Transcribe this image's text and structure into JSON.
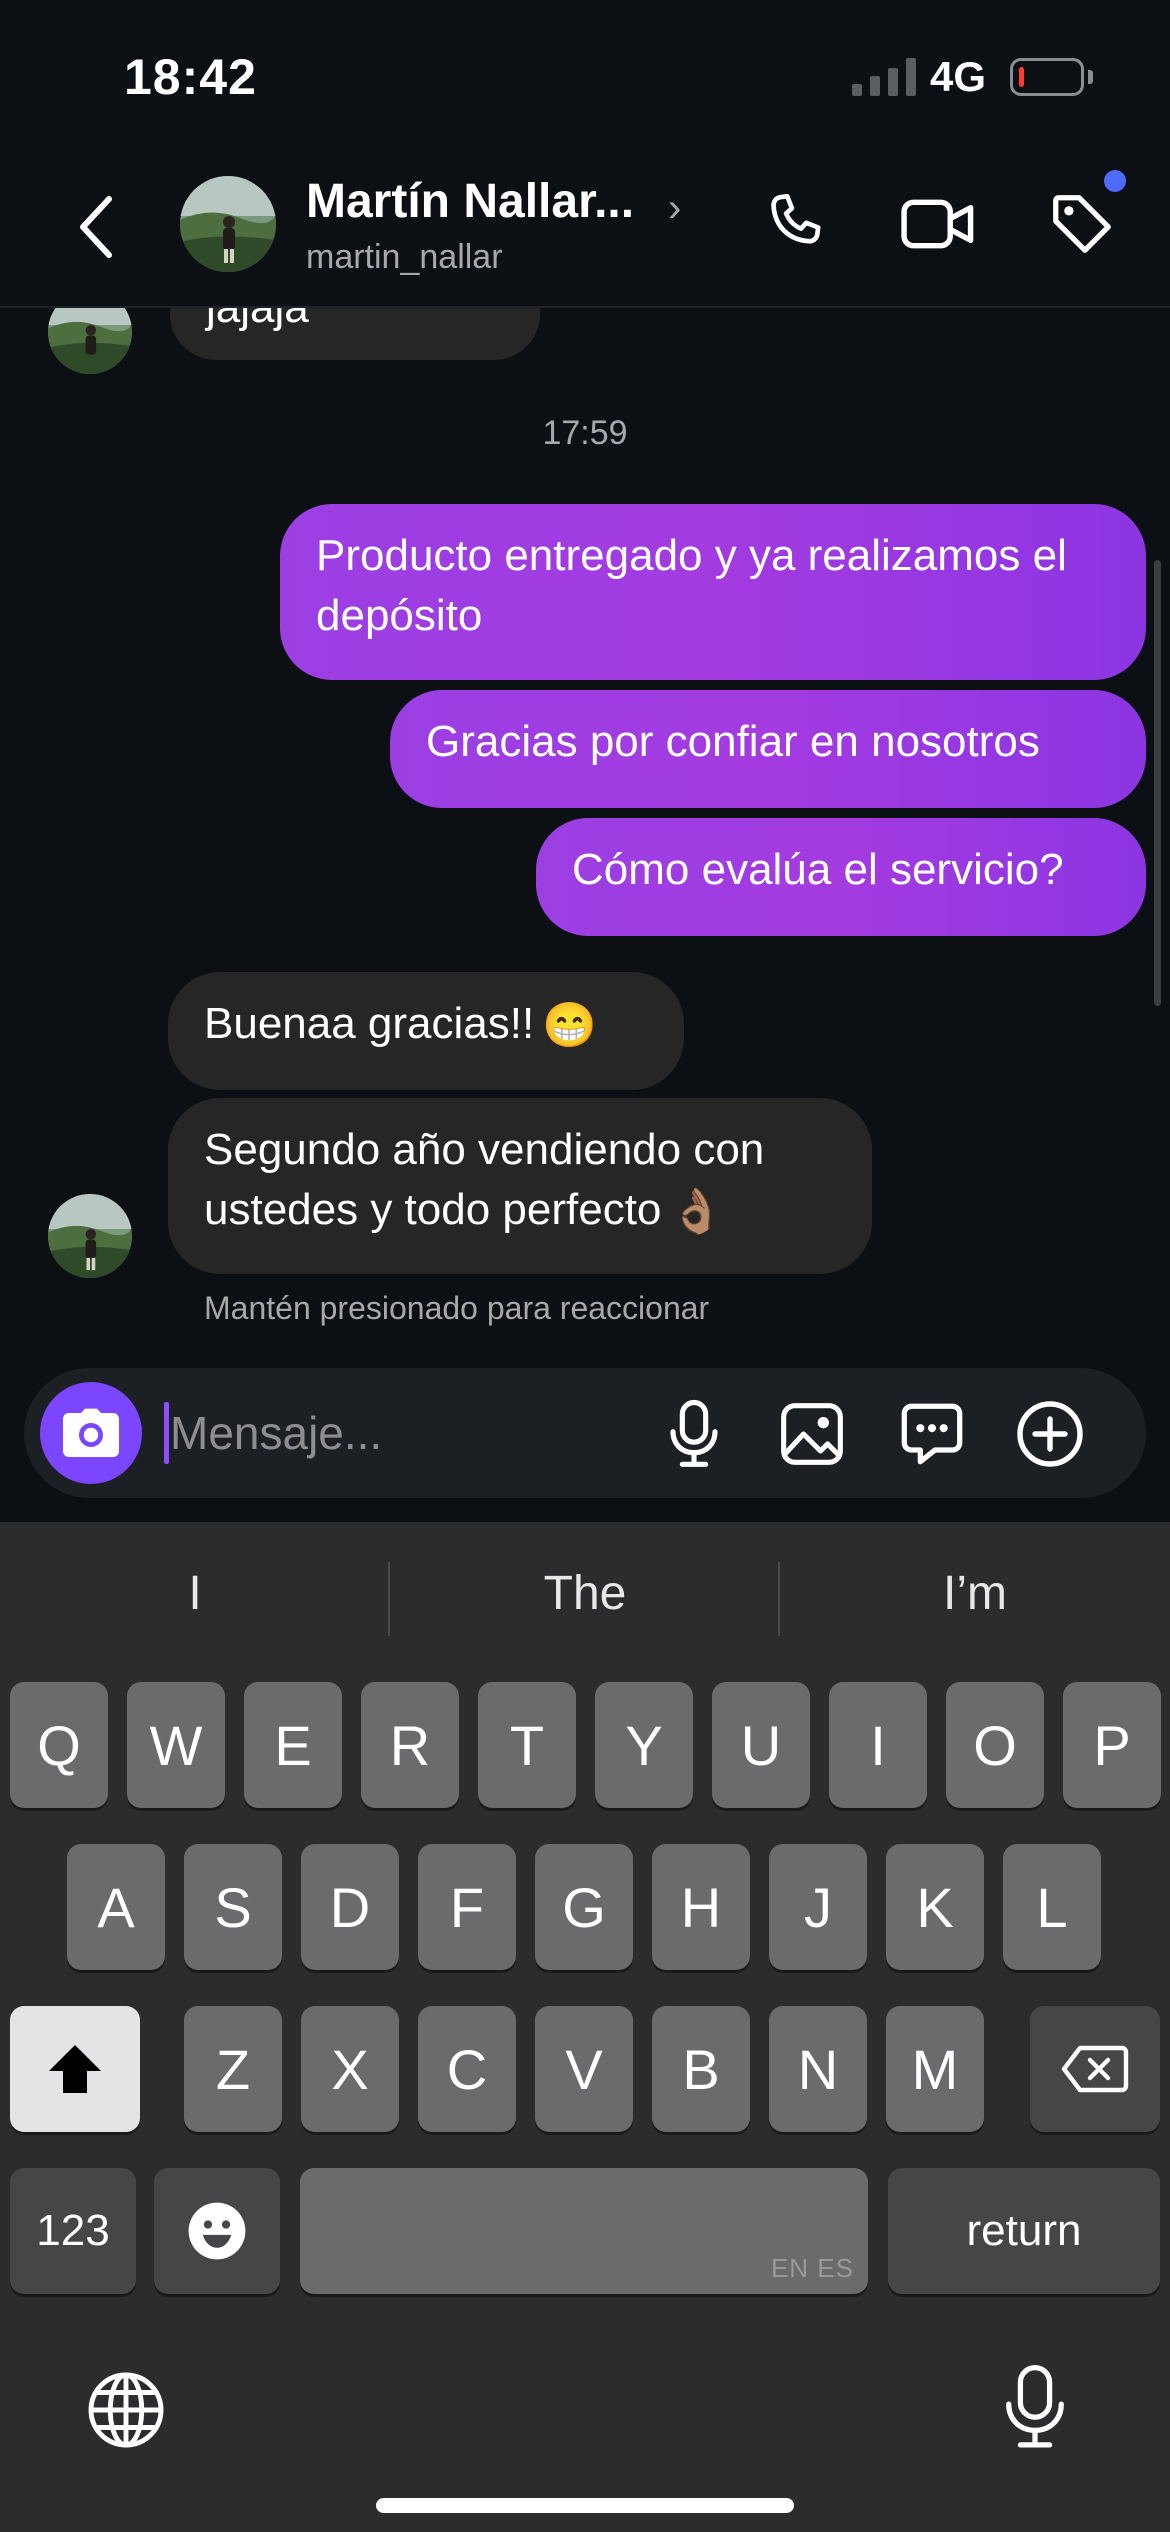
{
  "status_bar": {
    "time": "18:42",
    "network": "4G",
    "battery_color": "#ff3b30"
  },
  "header": {
    "contact_name": "Martín Nallar...",
    "username": "martin_nallar",
    "chevron": "›",
    "icons": [
      "back-chevron-icon",
      "phone-icon",
      "video-camera-icon",
      "tag-icon"
    ],
    "notification_dot_color": "#4f6bff"
  },
  "chat": {
    "partial_message": "jajaja",
    "timestamp": "17:59",
    "messages": [
      {
        "direction": "outgoing",
        "text": "Producto entregado y ya realizamos el depósito"
      },
      {
        "direction": "outgoing",
        "text": "Gracias por confiar en nosotros"
      },
      {
        "direction": "outgoing",
        "text": "Cómo evalúa el servicio?"
      },
      {
        "direction": "incoming",
        "text": "Buenaa gracias!!",
        "emoji": "😁"
      },
      {
        "direction": "incoming",
        "text": "Segundo año vendiendo con ustedes y todo perfecto",
        "emoji": "👌🏽"
      }
    ],
    "react_hint": "Mantén presionado para reaccionar",
    "outgoing_color": "#9b3fe3",
    "incoming_color": "#262626"
  },
  "composer": {
    "placeholder": "Mensaje...",
    "value": "",
    "icons": [
      "camera-icon",
      "microphone-icon",
      "gallery-icon",
      "sticker-icon",
      "plus-icon"
    ],
    "camera_button_color": "#7c46ff"
  },
  "keyboard": {
    "suggestions": [
      "I",
      "The",
      "I’m"
    ],
    "row1": [
      "Q",
      "W",
      "E",
      "R",
      "T",
      "Y",
      "U",
      "I",
      "O",
      "P"
    ],
    "row2": [
      "A",
      "S",
      "D",
      "F",
      "G",
      "H",
      "J",
      "K",
      "L"
    ],
    "row3": [
      "Z",
      "X",
      "C",
      "V",
      "B",
      "N",
      "M"
    ],
    "numbers_label": "123",
    "space_language": "EN ES",
    "return_label": "return"
  }
}
